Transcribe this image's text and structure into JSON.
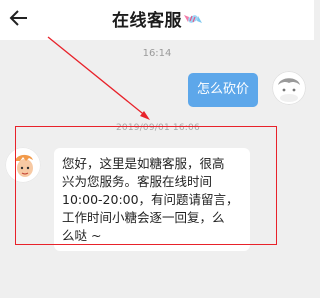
{
  "header": {
    "back_icon": "back-arrow-icon",
    "title": "在线客服",
    "title_icon": "candy-icon"
  },
  "chat": {
    "timestamp": "16:14",
    "user_message": "怎么砍价",
    "agent_time": "2019/09/01 16:06",
    "agent_message_lines": [
      "您好，这里是如糖客服，很高",
      "兴为您服务。客服在线时间",
      "10:00-20:00，有问题请留言，",
      "工作时间小糖会逐一回复，么",
      "么哒 ~"
    ]
  },
  "colors": {
    "user_bubble": "#5da7ea",
    "annotation": "#e8222a",
    "background": "#efefef"
  }
}
